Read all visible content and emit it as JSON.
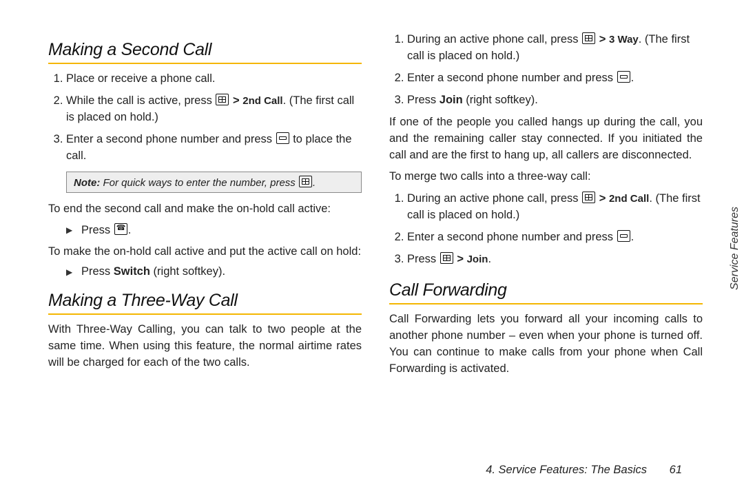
{
  "left": {
    "h1": "Making a Second Call",
    "ol1": {
      "i1": "Place or receive a phone call.",
      "i2a": "While the call is active, press ",
      "i2_key": "2nd Call",
      "i2b": ". (The first call is placed on hold.)",
      "i3a": "Enter a second phone number and press ",
      "i3b": " to place the call."
    },
    "note_label": "Note:",
    "note_text": " For quick ways to enter the number, press ",
    "p1": "To end the second call and make the on-hold call active:",
    "b1": "Press ",
    "b1b": ".",
    "p2": "To make the on-hold call active and put the active call on hold:",
    "b2a": "Press ",
    "b2_key": "Switch",
    "b2b": " (right softkey).",
    "h2": "Making a Three-Way Call",
    "p3": "With Three-Way Calling, you can talk to two people at the same time. When using this feature, the normal airtime rates will be charged for each of the two calls."
  },
  "right": {
    "ol1": {
      "i1a": "During an active phone call, press ",
      "i1_key": "3 Way",
      "i1b": ". (The first call is placed on hold.)",
      "i2a": "Enter a second phone number and press ",
      "i2b": ".",
      "i3a": "Press ",
      "i3_key": "Join",
      "i3b": " (right softkey)."
    },
    "p1": "If one of the people you called hangs up during the call, you and the remaining caller stay connected. If you initiated the call and are the first to hang up, all callers are disconnected.",
    "p2": "To merge two calls into a three-way call:",
    "ol2": {
      "i1a": "During an active phone call, press ",
      "i1_key": "2nd Call",
      "i1b": ". (The first call is placed on hold.)",
      "i2a": "Enter a second phone number and press ",
      "i2b": ".",
      "i3a": "Press ",
      "i3_key": "Join",
      "i3b": "."
    },
    "h1": "Call Forwarding",
    "p3": "Call Forwarding lets you forward all your incoming calls to another phone number – even when your phone is turned off. You can continue to make calls from your phone when Call Forwarding is activated."
  },
  "footer": {
    "section": "4. Service Features: The Basics",
    "page": "61"
  },
  "sidetab": "Service Features",
  "gt": ">"
}
